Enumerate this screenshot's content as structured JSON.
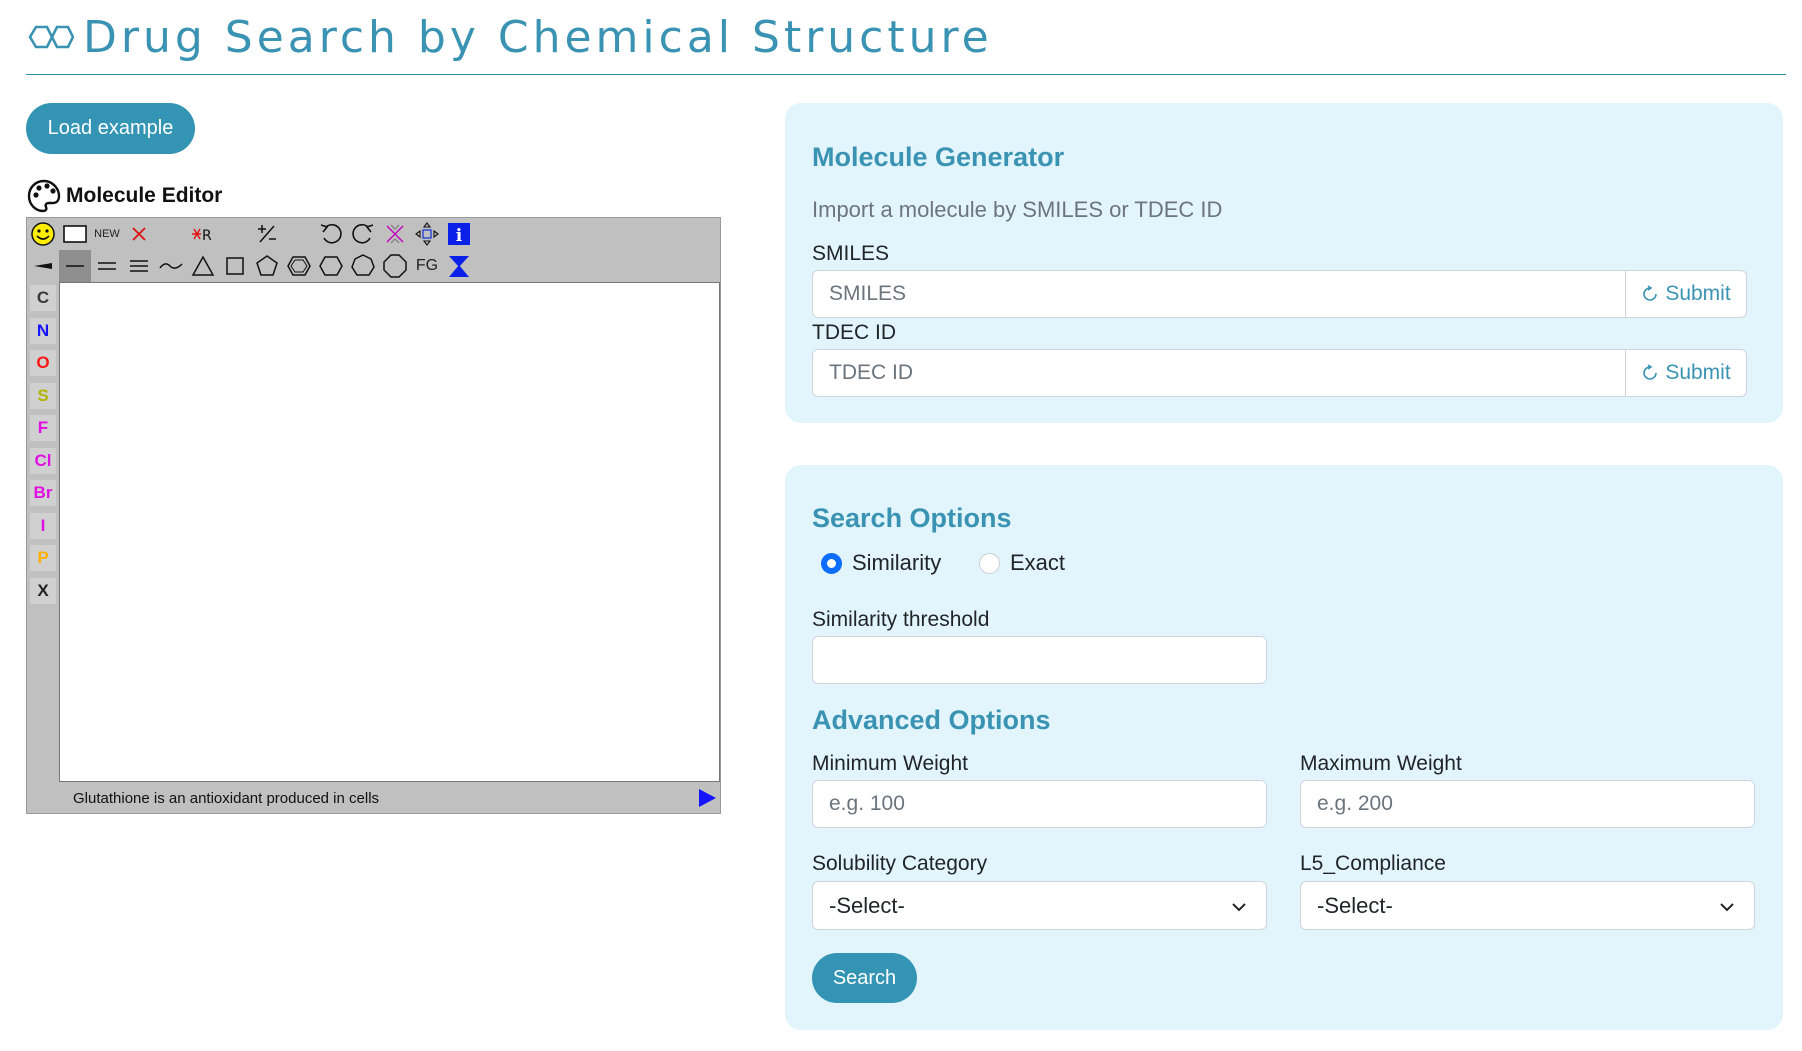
{
  "header": {
    "title": "Drug Search by Chemical Structure",
    "logo_icon": "molecule-icon"
  },
  "load_example": {
    "label": "Load example"
  },
  "editor": {
    "title": "Molecule Editor",
    "title_icon": "palette-icon",
    "toolbar_row1": [
      "smiley-icon",
      "rectangle-icon",
      "NEW",
      "delete-x-icon",
      "",
      "delete-r-icon",
      "",
      "charge-icon",
      "",
      "undo-icon",
      "redo-icon",
      "clear-icon",
      "move-icon",
      "info-icon"
    ],
    "toolbar_row2": [
      "wedge-bond-icon",
      "single-bond-icon",
      "double-bond-icon",
      "triple-bond-icon",
      "chain-icon",
      "triangle-icon",
      "square-icon",
      "pentagon-icon",
      "benzene-icon",
      "hexagon-icon",
      "heptagon-icon",
      "octagon-icon",
      "FG",
      "template-icon"
    ],
    "atoms": [
      {
        "label": "C",
        "color": "#3a3a3a"
      },
      {
        "label": "N",
        "color": "#1414ff"
      },
      {
        "label": "O",
        "color": "#ff1414"
      },
      {
        "label": "S",
        "color": "#b3b300"
      },
      {
        "label": "F",
        "color": "#e010e0"
      },
      {
        "label": "Cl",
        "color": "#e010e0"
      },
      {
        "label": "Br",
        "color": "#e010e0"
      },
      {
        "label": "I",
        "color": "#e010e0"
      },
      {
        "label": "P",
        "color": "#ffb000"
      },
      {
        "label": "X",
        "color": "#222222"
      }
    ],
    "status_text": "Glutathione is an antioxidant produced in cells"
  },
  "generator": {
    "title": "Molecule Generator",
    "subtitle": "Import a molecule by SMILES or TDEC ID",
    "smiles_label": "SMILES",
    "smiles_placeholder": "SMILES",
    "tdec_label": "TDEC ID",
    "tdec_placeholder": "TDEC ID",
    "submit_label": "Submit"
  },
  "search_options": {
    "title": "Search Options",
    "radio_similarity": "Similarity",
    "radio_exact": "Exact",
    "selected": "Similarity",
    "threshold_label": "Similarity threshold",
    "threshold_value": "",
    "advanced_title": "Advanced Options",
    "min_weight_label": "Minimum Weight",
    "min_weight_placeholder": "e.g. 100",
    "max_weight_label": "Maximum Weight",
    "max_weight_placeholder": "e.g. 200",
    "solubility_label": "Solubility Category",
    "solubility_value": "-Select-",
    "l5_label": "L5_Compliance",
    "l5_value": "-Select-",
    "search_label": "Search"
  },
  "colors": {
    "accent": "#3494b4",
    "card_bg": "#e3f5fc",
    "radio_on": "#0d6efd"
  }
}
